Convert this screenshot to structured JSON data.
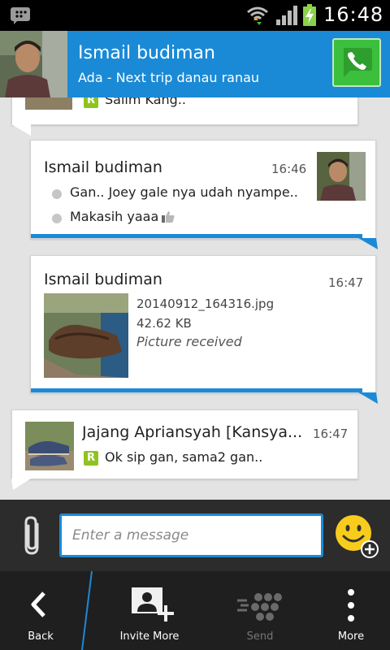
{
  "status_bar": {
    "time": "16:48"
  },
  "header": {
    "name": "Ismail budiman",
    "status": "Ada - Next trip danau ranau"
  },
  "messages": [
    {
      "text": "Salim Kang.."
    },
    {
      "sender": "Ismail budiman",
      "time": "16:46",
      "lines": [
        "Gan.. Joey gale nya udah nyampe..",
        "Makasih yaaa"
      ]
    },
    {
      "sender": "Ismail budiman",
      "time": "16:47",
      "file_name": "20140912_164316.jpg",
      "file_size": "42.62 KB",
      "file_status": "Picture received"
    },
    {
      "sender": "Jajang Apriansyah [Kansya...",
      "time": "16:47",
      "text": "Ok sip gan, sama2 gan.."
    }
  ],
  "composer": {
    "placeholder": "Enter a message"
  },
  "bottom_nav": {
    "back": "Back",
    "invite": "Invite More",
    "send": "Send",
    "more": "More"
  },
  "colors": {
    "accent": "#1a8ad6",
    "read_icon": "#8fc31f",
    "call_button": "#3cbf3c"
  }
}
